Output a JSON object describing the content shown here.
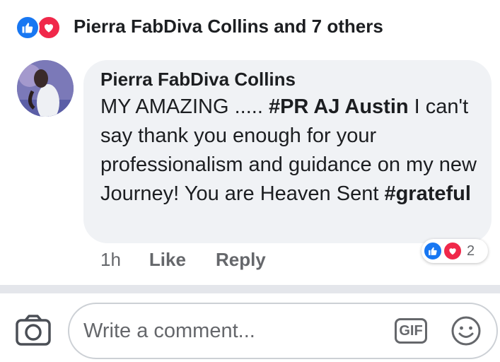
{
  "reactions": {
    "names": "Pierra FabDiva Collins and 7 others",
    "icons": [
      "like-icon",
      "love-icon"
    ],
    "colors": {
      "like": "#1877f2",
      "love": "#f0284a"
    }
  },
  "comment": {
    "author": "Pierra FabDiva Collins",
    "segments": [
      {
        "text": "MY AMAZING ..... ",
        "bold": false
      },
      {
        "text": "#PR AJ Austin",
        "bold": true
      },
      {
        "text": " I can't say thank you enough for your professionalism and guidance on my new Journey! You are Heaven Sent ",
        "bold": false
      },
      {
        "text": "#grateful",
        "bold": true
      }
    ],
    "time": "1h",
    "like_label": "Like",
    "reply_label": "Reply",
    "reaction_count": "2"
  },
  "composer": {
    "placeholder": "Write a comment...",
    "gif_label": "GIF"
  }
}
